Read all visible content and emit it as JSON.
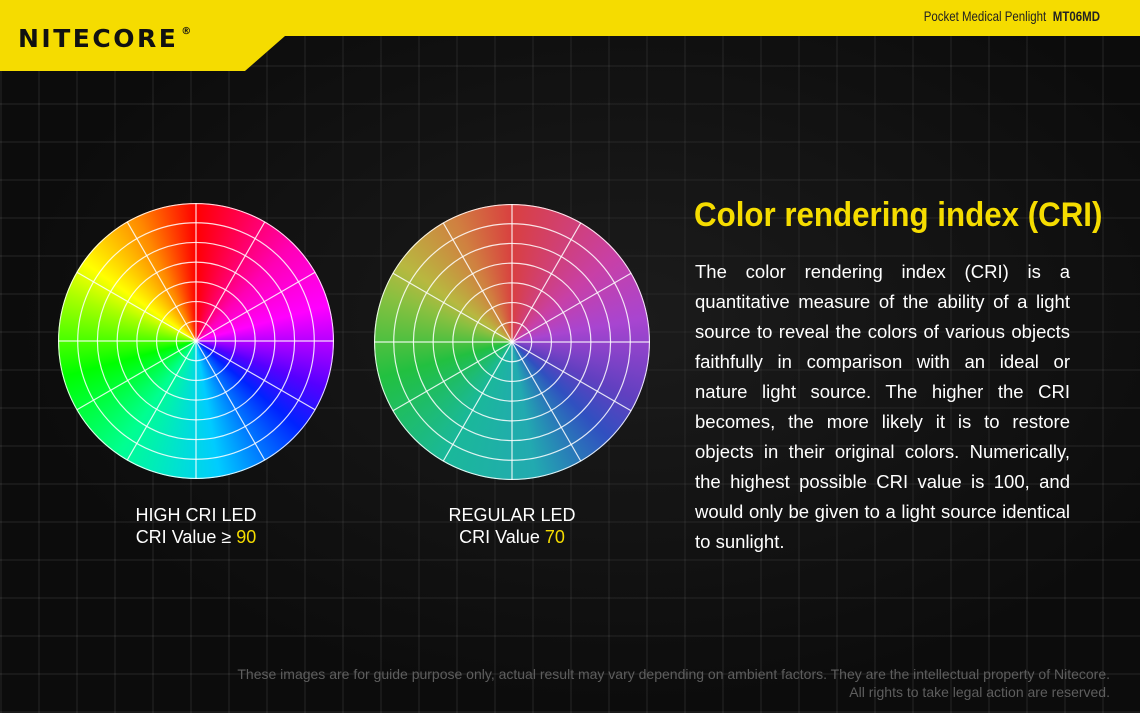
{
  "header": {
    "brand": "NITECORE",
    "registered_mark": "®",
    "product_name": "Pocket Medical Penlight",
    "model": "MT06MD"
  },
  "wheels": {
    "high": {
      "line1": "HIGH CRI LED",
      "value_prefix": "CRI Value ≥ ",
      "value": "90"
    },
    "regular": {
      "line1": "REGULAR LED",
      "value_prefix": "CRI Value ",
      "value": "70"
    }
  },
  "info": {
    "title": "Color rendering index (CRI)",
    "body": "The color rendering index (CRI) is a quantitative measure of the ability of a light source to reveal the colors of various objects faithfully in comparison with an ideal or nature light source. The higher the CRI becomes, the more likely it is to restore objects in their original colors. Numerically, the highest possible CRI value is 100, and would only be given to a light source identical to sunlight."
  },
  "footer": {
    "line1": "These images are for guide purpose only, actual result may vary depending on ambient factors. They are the intellectual property of Nitecore.",
    "line2": "All rights to take legal action are reserved."
  },
  "colors": {
    "brand_yellow": "#f5dc00",
    "background": "#0c0c0c",
    "text": "#ffffff"
  }
}
